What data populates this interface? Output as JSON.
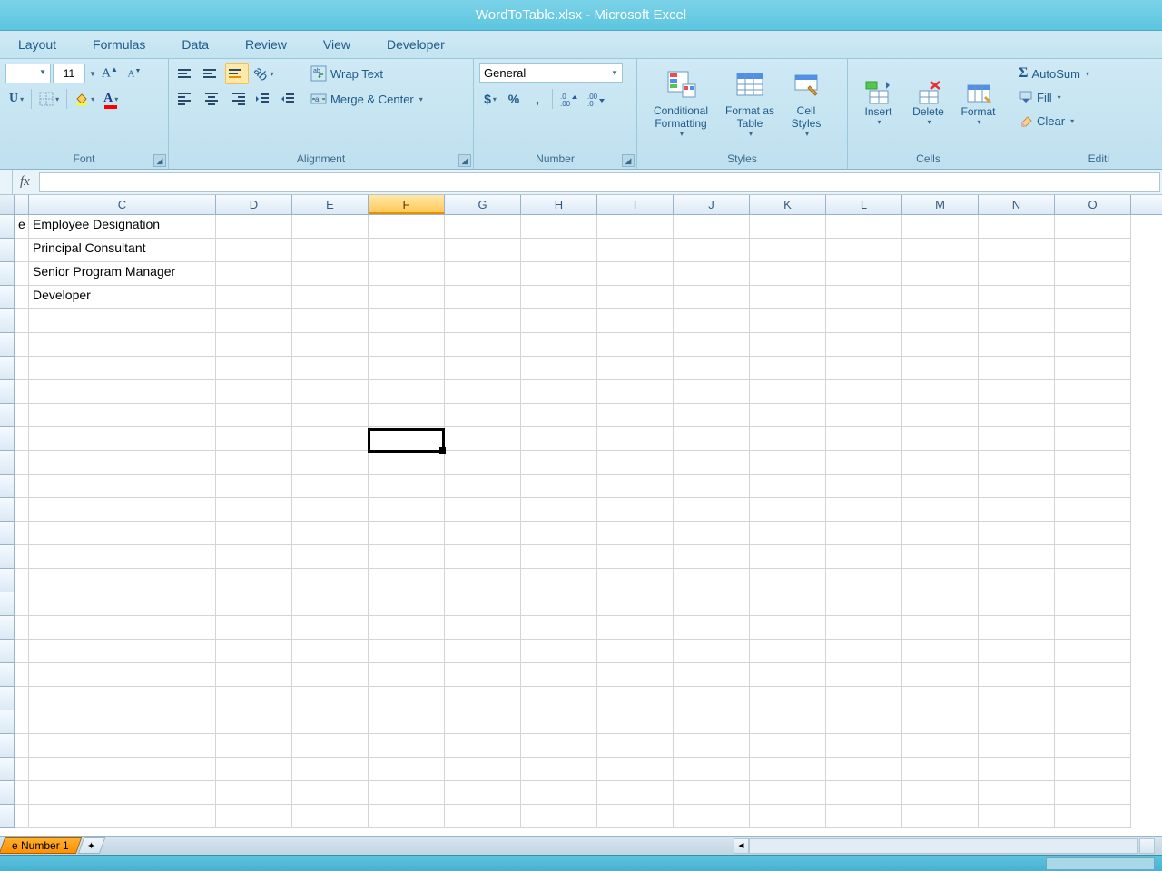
{
  "title": "WordToTable.xlsx - Microsoft Excel",
  "tabs": {
    "layout": "Layout",
    "formulas": "Formulas",
    "data": "Data",
    "review": "Review",
    "view": "View",
    "developer": "Developer"
  },
  "ribbon": {
    "font": {
      "size": "11",
      "group_label": "Font"
    },
    "alignment": {
      "wrap_text": "Wrap Text",
      "merge_center": "Merge & Center",
      "group_label": "Alignment"
    },
    "number": {
      "format": "General",
      "group_label": "Number"
    },
    "styles": {
      "conditional": "Conditional Formatting",
      "as_table": "Format as Table",
      "cell_styles": "Cell Styles",
      "group_label": "Styles"
    },
    "cells": {
      "insert": "Insert",
      "delete": "Delete",
      "format": "Format",
      "group_label": "Cells"
    },
    "editing": {
      "autosum": "AutoSum",
      "fill": "Fill",
      "clear": "Clear",
      "group_label": "Editi"
    }
  },
  "formula_bar": {
    "label": "fx"
  },
  "columns": [
    "C",
    "D",
    "E",
    "F",
    "G",
    "H",
    "I",
    "J",
    "K",
    "L",
    "M",
    "N",
    "O"
  ],
  "column_widths": {
    "rowhead": 16,
    "partial": 16,
    "C": 206,
    "D": 84,
    "E": 84,
    "F": 84,
    "G": 84,
    "H": 84,
    "I": 84,
    "J": 84,
    "K": 84,
    "L": 84,
    "M": 84,
    "N": 84,
    "O": 84
  },
  "cells": {
    "B1_partial": "e",
    "C1": "Employee Designation",
    "C2": "Principal Consultant",
    "C3": "Senior Program Manager",
    "C4": "Developer"
  },
  "selected_column": "F",
  "selected_cell": "F10",
  "sheet": {
    "active_tab": "e Number 1"
  }
}
